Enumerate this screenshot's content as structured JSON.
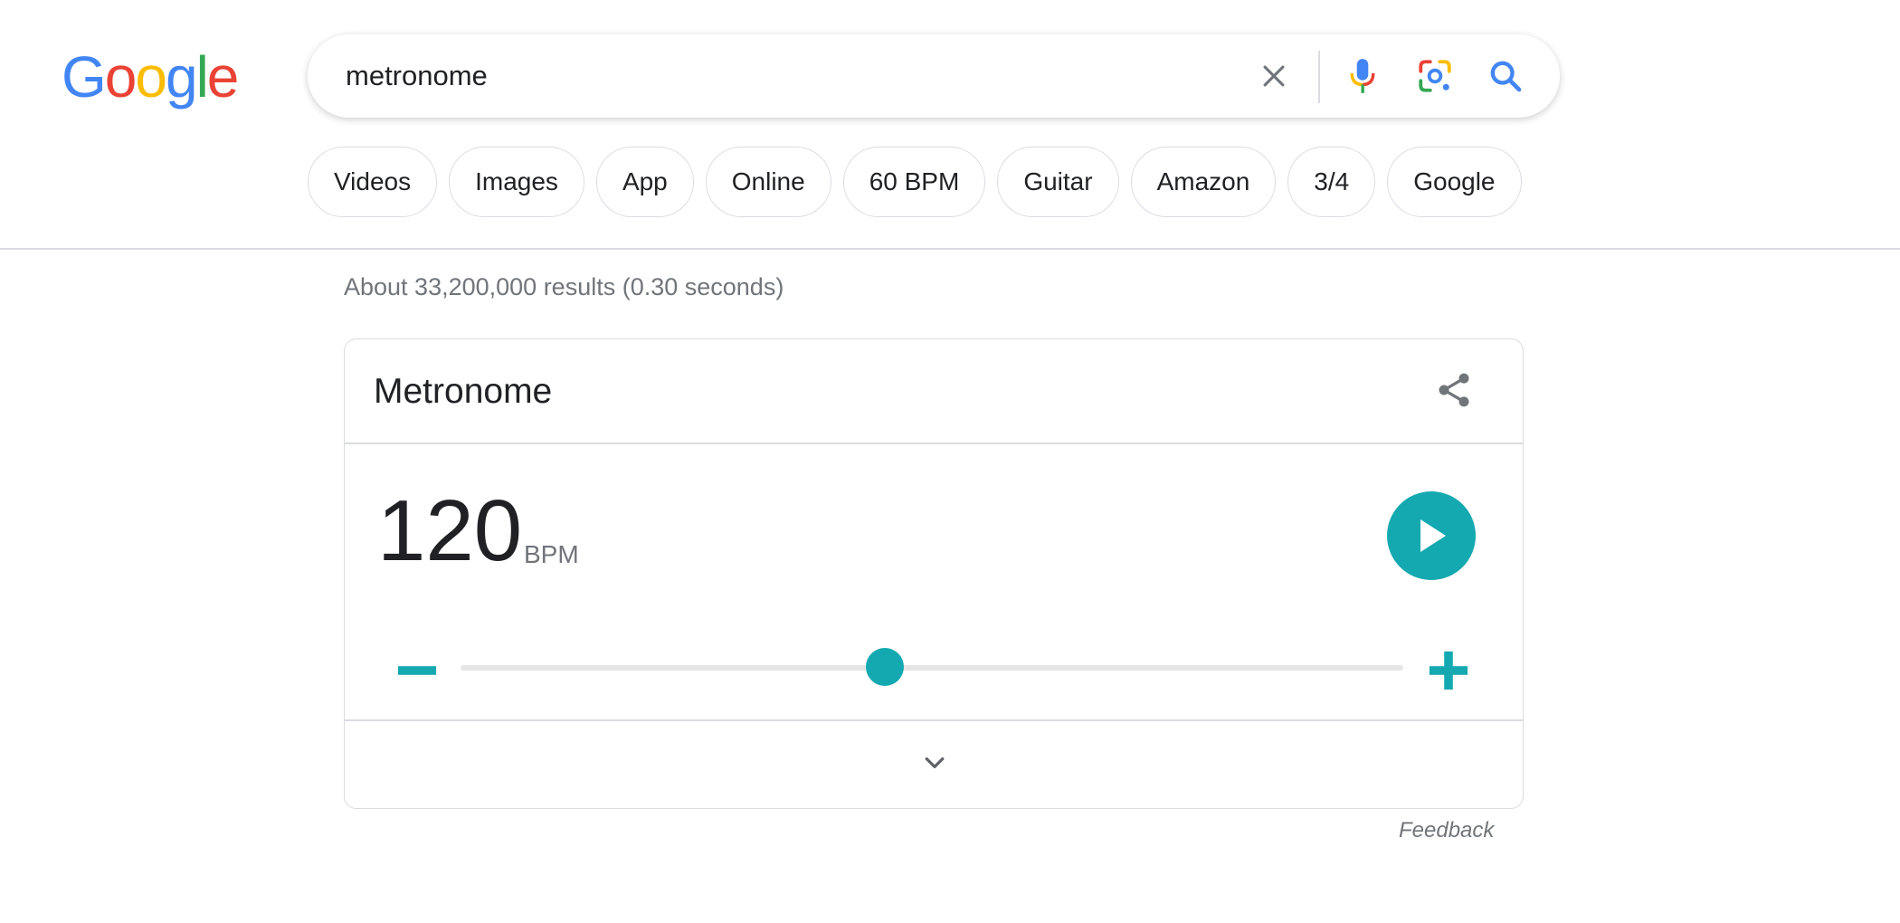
{
  "logo": {
    "letters": [
      "G",
      "o",
      "o",
      "g",
      "l",
      "e"
    ],
    "colors": [
      "#4285F4",
      "#EA4335",
      "#FBBC05",
      "#4285F4",
      "#34A853",
      "#EA4335"
    ]
  },
  "search": {
    "query": "metronome",
    "placeholder": ""
  },
  "search_icons": [
    "clear-icon",
    "microphone-icon",
    "lens-camera-icon",
    "search-icon"
  ],
  "chips": [
    "Videos",
    "Images",
    "App",
    "Online",
    "60 BPM",
    "Guitar",
    "Amazon",
    "3/4",
    "Google"
  ],
  "results": {
    "stats": "About 33,200,000 results (0.30 seconds)"
  },
  "metronome": {
    "title": "Metronome",
    "bpm": "120",
    "bpm_unit": "BPM",
    "slider_fraction": 0.45,
    "accent_color": "#14a9b0",
    "icons": {
      "share": "share-icon",
      "play": "play-icon",
      "minus": "minus-icon",
      "plus": "plus-icon",
      "expand": "chevron-down-icon"
    }
  },
  "feedback": "Feedback"
}
